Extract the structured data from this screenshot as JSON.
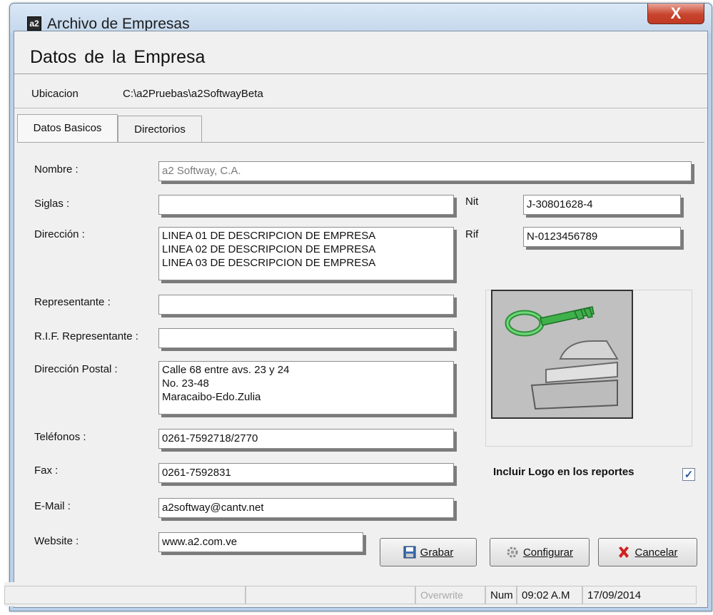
{
  "window": {
    "title": "Archivo de Empresas",
    "close_glyph": "X"
  },
  "header": {
    "title": "Datos de la Empresa"
  },
  "location": {
    "label": "Ubicacion",
    "value": "C:\\a2Pruebas\\a2SoftwayBeta"
  },
  "tabs": [
    {
      "label": "Datos Basicos"
    },
    {
      "label": "Directorios"
    }
  ],
  "form": {
    "nombre": {
      "label": "Nombre :",
      "value": "a2 Softway, C.A."
    },
    "siglas": {
      "label": "Siglas :",
      "value": ""
    },
    "nit": {
      "label": "Nit",
      "value": "J-30801628-4"
    },
    "direccion": {
      "label": "Dirección :",
      "value": "LINEA 01 DE DESCRIPCION DE EMPRESA\nLINEA 02 DE DESCRIPCION DE EMPRESA\nLINEA 03 DE DESCRIPCION DE EMPRESA"
    },
    "rif": {
      "label": "Rif",
      "value": "N-0123456789"
    },
    "representante": {
      "label": "Representante :",
      "value": ""
    },
    "rif_representante": {
      "label": "R.I.F. Representante :",
      "value": ""
    },
    "direccion_postal": {
      "label": "Dirección Postal :",
      "value": "Calle 68 entre avs. 23 y 24\nNo. 23-48\nMaracaibo-Edo.Zulia"
    },
    "telefonos": {
      "label": "Teléfonos :",
      "value": "0261-7592718/2770"
    },
    "fax": {
      "label": "Fax :",
      "value": "0261-7592831"
    },
    "email": {
      "label": "E-Mail :",
      "value": "a2softway@cantv.net"
    },
    "website": {
      "label": "Website :",
      "value": "www.a2.com.ve"
    }
  },
  "logo": {
    "icon": "key-lock-icon",
    "include_label": "Incluir Logo en los reportes",
    "include_checked": true
  },
  "buttons": {
    "grabar": "Grabar",
    "configurar": "Configurar",
    "cancelar": "Cancelar"
  },
  "statusbar": {
    "overwrite": "Overwrite",
    "num": "Num",
    "time": "09:02 A.M",
    "date": "17/09/2014"
  },
  "colors": {
    "title_bar": "#c3d7ec",
    "close_button": "#c8432d",
    "key_green": "#3fb04a",
    "cancel_x": "#d21f1f"
  }
}
